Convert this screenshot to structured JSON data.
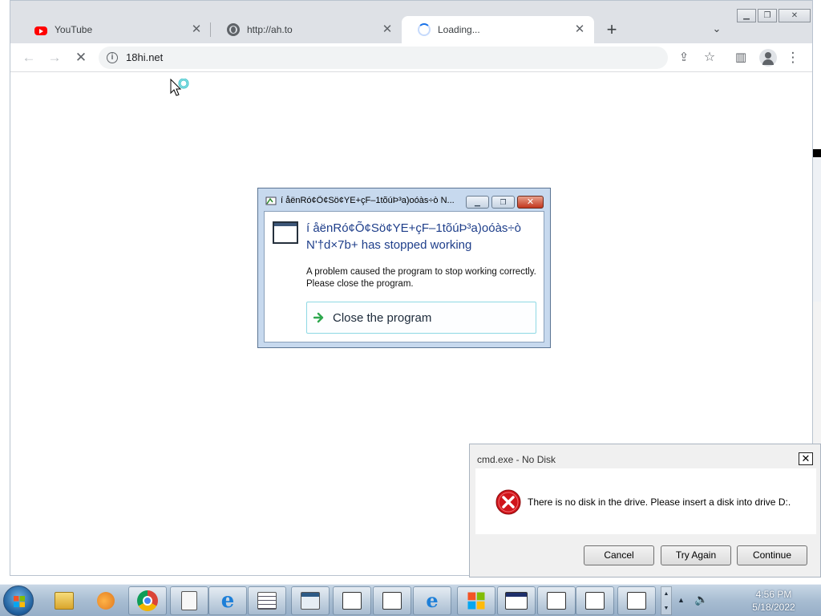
{
  "browser": {
    "tabs": [
      {
        "title": "YouTube",
        "icon": "youtube-icon",
        "state": "inactive"
      },
      {
        "title": "http://ah.to",
        "icon": "globe-icon",
        "state": "inactive"
      },
      {
        "title": "Loading...",
        "icon": "loading-spinner-icon",
        "state": "active"
      }
    ],
    "new_tab_icon": "plus-icon",
    "tab_search_icon": "chevron-down-icon",
    "window_buttons": {
      "minimize": "minimize-icon",
      "restore": "restore-icon",
      "close": "close-icon"
    },
    "toolbar": {
      "back_icon": "arrow-left-icon",
      "forward_icon": "arrow-right-icon",
      "stop_icon": "stop-loading-icon",
      "url": "18hi.net",
      "site_info_icon": "info-icon",
      "share_icon": "share-icon",
      "bookmark_icon": "star-icon",
      "sidepanel_icon": "side-panel-icon",
      "profile_icon": "profile-icon",
      "menu_icon": "kebab-menu-icon"
    }
  },
  "crash_dialog": {
    "title": "í åënRó¢Õ¢Sö¢YE+çF–1tõúÞ³a)oóàs÷ò N...",
    "heading": "í åënRó¢Õ¢Sö¢YE+çF–1tõúÞ³a)oóàs÷ò N'†d×7b+ has stopped working",
    "message": "A problem caused the program to stop working correctly. Please close the program.",
    "action_label": "Close the program",
    "action_icon": "green-arrow-icon",
    "colors": {
      "heading": "#1e3e8a",
      "frame": "#c7d9ee"
    }
  },
  "nodisk_dialog": {
    "title": "cmd.exe - No Disk",
    "message": "There is no disk in the drive. Please insert a disk into drive D:.",
    "icon": "error-icon",
    "buttons": [
      "Cancel",
      "Try Again",
      "Continue"
    ],
    "colors": {
      "error": "#d0151b"
    }
  },
  "taskbar": {
    "start_icon": "windows-start-icon",
    "items": [
      {
        "name": "explorer-libraries-icon",
        "open": false
      },
      {
        "name": "media-player-icon",
        "open": false
      },
      {
        "name": "chrome-icon",
        "open": true
      },
      {
        "name": "notepad-icon",
        "open": true
      },
      {
        "name": "internet-explorer-icon",
        "open": true
      },
      {
        "name": "list-window-icon",
        "open": true
      },
      {
        "name": "window-icon",
        "open": true
      },
      {
        "name": "folder-icon",
        "open": true
      },
      {
        "name": "folder-icon",
        "open": true
      },
      {
        "name": "ie-page-icon",
        "open": true
      },
      {
        "name": "windows-logo-icon",
        "open": true
      },
      {
        "name": "window-icon",
        "open": true
      },
      {
        "name": "folder-icon",
        "open": true
      },
      {
        "name": "folder-icon",
        "open": true
      },
      {
        "name": "folder-icon",
        "open": true
      }
    ],
    "tray": {
      "show_hidden_icon": "triangle-up-icon",
      "volume_icon": "speaker-icon"
    },
    "clock": {
      "time": "4:56 PM",
      "date": "5/18/2022"
    }
  }
}
